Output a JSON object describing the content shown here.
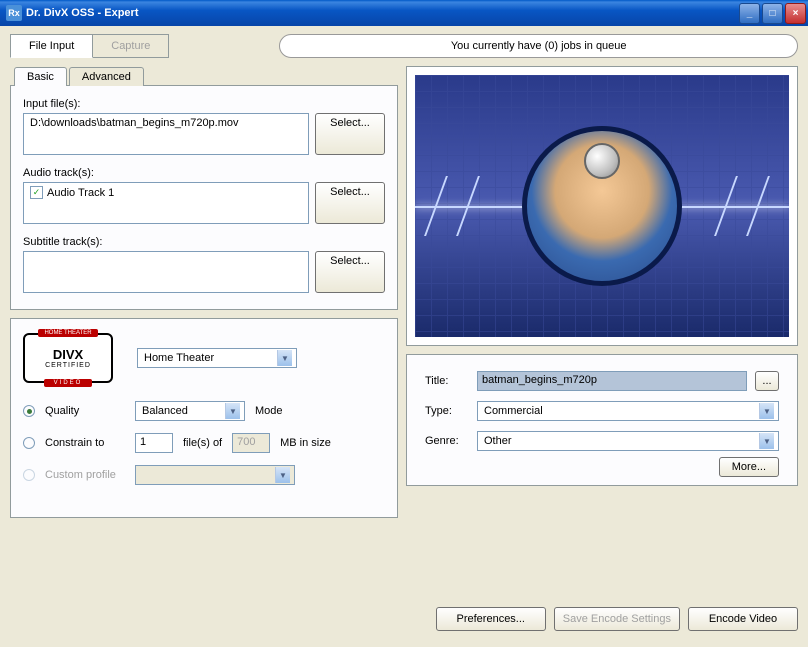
{
  "window": {
    "title": "Dr. DivX OSS - Expert"
  },
  "topTabs": {
    "fileInput": "File Input",
    "capture": "Capture"
  },
  "queue": {
    "text": "You currently have (0) jobs in queue"
  },
  "innerTabs": {
    "basic": "Basic",
    "advanced": "Advanced"
  },
  "inputs": {
    "inputFilesLabel": "Input file(s):",
    "inputFile": "D:\\downloads\\batman_begins_m720p.mov",
    "audioLabel": "Audio track(s):",
    "audioTrack": "Audio Track 1",
    "subtitleLabel": "Subtitle track(s):",
    "selectBtn": "Select..."
  },
  "profile": {
    "preset": "Home Theater",
    "qualityLabel": "Quality",
    "qualityValue": "Balanced",
    "modeLabel": "Mode",
    "constrainLabel": "Constrain to",
    "filesCount": "1",
    "filesOf": "file(s) of",
    "mbValue": "700",
    "mbLabel": "MB in size",
    "customLabel": "Custom profile"
  },
  "meta": {
    "titleLabel": "Title:",
    "titleValue": "batman_begins_m720p",
    "typeLabel": "Type:",
    "typeValue": "Commercial",
    "genreLabel": "Genre:",
    "genreValue": "Other",
    "moreBtn": "More..."
  },
  "buttons": {
    "preferences": "Preferences...",
    "saveEncode": "Save Encode Settings",
    "encodeVideo": "Encode Video"
  },
  "logo": {
    "main": "DIVX",
    "sub": "CERTIFIED"
  }
}
